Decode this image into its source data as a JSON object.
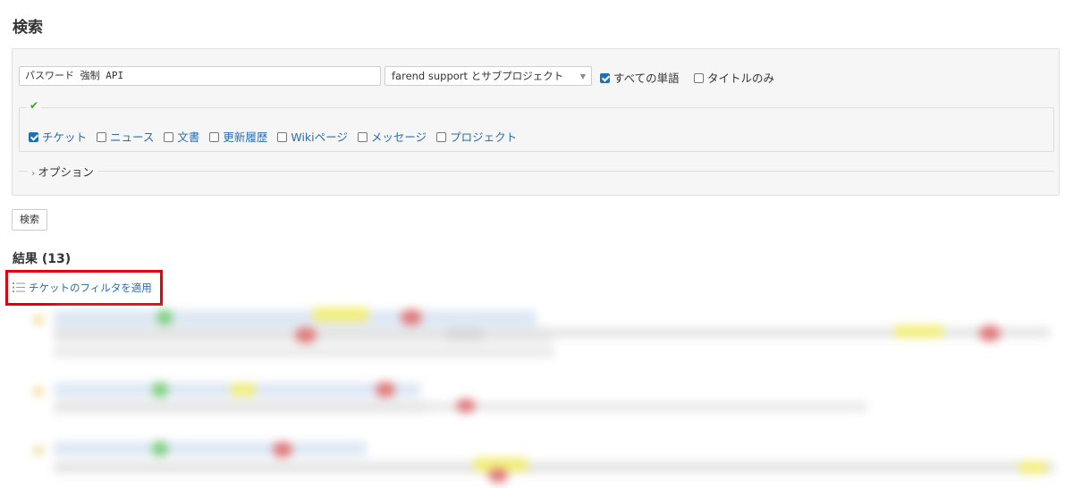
{
  "page": {
    "title": "検索"
  },
  "search": {
    "query": "パスワード 強制 API",
    "scope_selected": "farend support とサブプロジェクト",
    "all_words": {
      "label": "すべての単語",
      "checked": true
    },
    "titles_only": {
      "label": "タイトルのみ",
      "checked": false
    },
    "types": [
      {
        "label": "チケット",
        "checked": true
      },
      {
        "label": "ニュース",
        "checked": false
      },
      {
        "label": "文書",
        "checked": false
      },
      {
        "label": "更新履歴",
        "checked": false
      },
      {
        "label": "Wikiページ",
        "checked": false
      },
      {
        "label": "メッセージ",
        "checked": false
      },
      {
        "label": "プロジェクト",
        "checked": false
      }
    ],
    "options_label": "オプション",
    "submit_label": "検索"
  },
  "results": {
    "heading": "結果 (13)",
    "apply_filter_label": "チケットのフィルタを適用"
  },
  "colors": {
    "link": "#2a6cb0",
    "checkbox": "#1f6fb5",
    "highlight_box": "#e3000b"
  }
}
